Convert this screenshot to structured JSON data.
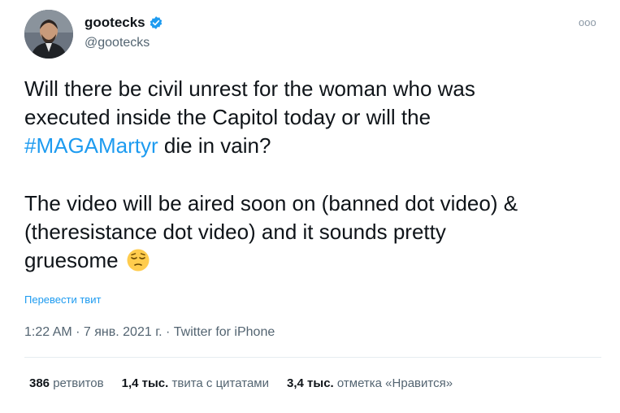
{
  "author": {
    "display_name": "gootecks",
    "handle": "@gootecks",
    "verified_icon": "verified-badge-icon",
    "accent": "#1d9bf0"
  },
  "menu": {
    "icon": "more-options-icon",
    "glyph": "ooo"
  },
  "tweet": {
    "line1a": "Will there be civil unrest for the woman who was",
    "line1b": "executed inside the Capitol today or will the",
    "hashtag": "#MAGAMartyr",
    "line1c": " die in vain?",
    "line2a": "The video will be aired soon on (banned dot video) &",
    "line2b": "(theresistance dot video)  and it sounds pretty",
    "line2c": "gruesome",
    "emoji_icon": "pensive-face-icon"
  },
  "translate_label": "Перевести твит",
  "meta": {
    "time": "1:22 AM",
    "sep1": " · ",
    "date": "7 янв. 2021 г.",
    "sep2": " · ",
    "source": "Twitter for iPhone"
  },
  "stats": {
    "retweets_num": "386",
    "retweets_label": "ретвитов",
    "quotes_num": "1,4 тыс.",
    "quotes_label": "твита с цитатами",
    "likes_num": "3,4 тыс.",
    "likes_label": "отметка «Нравится»"
  }
}
